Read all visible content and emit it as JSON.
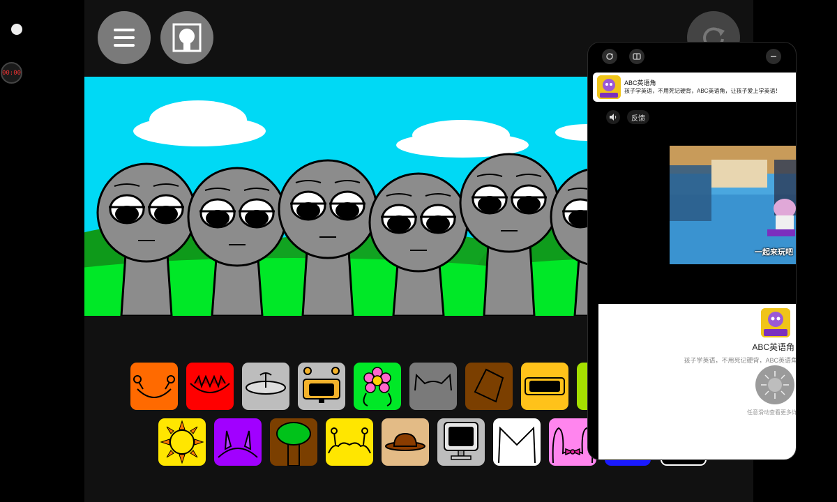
{
  "overlay": {
    "timer": "00:00"
  },
  "game": {
    "menu_icon": "hamburger-menu-icon",
    "avatar_icon": "character-silhouette-icon",
    "reset_icon": "refresh-icon",
    "palette_row1": [
      "orange-antenna-head",
      "red-spiky-hat",
      "gray-ufo-hat",
      "visor-head",
      "pink-flower",
      "cat-ears",
      "brown-bucket-hat",
      "yellow-visor",
      "green-partial"
    ],
    "palette_row2": [
      "sun-head",
      "purple-horns",
      "tree-head",
      "yellow-antenna-head",
      "brown-bowler-hat",
      "computer-monitor",
      "white-cat-ears",
      "pink-bunny-bow"
    ]
  },
  "mini_window": {
    "notification": {
      "app_name": "ABC英语角",
      "text": "孩子学英语，不用死记硬背，ABC英语角，让孩子爱上学英语！"
    },
    "sound_icon": "speaker-icon",
    "feedback_label": "反馈",
    "video_caption": "一起来玩吧",
    "app_logo_text": "英语角",
    "card": {
      "app_name": "ABC英语角",
      "description": "孩子学英语，不用死记硬背，ABC英语角",
      "hint": "任意滑动查看更多详"
    },
    "colors": {
      "accent": "#f0c419",
      "sky": "#00d9f5",
      "grass": "#00e827"
    }
  }
}
